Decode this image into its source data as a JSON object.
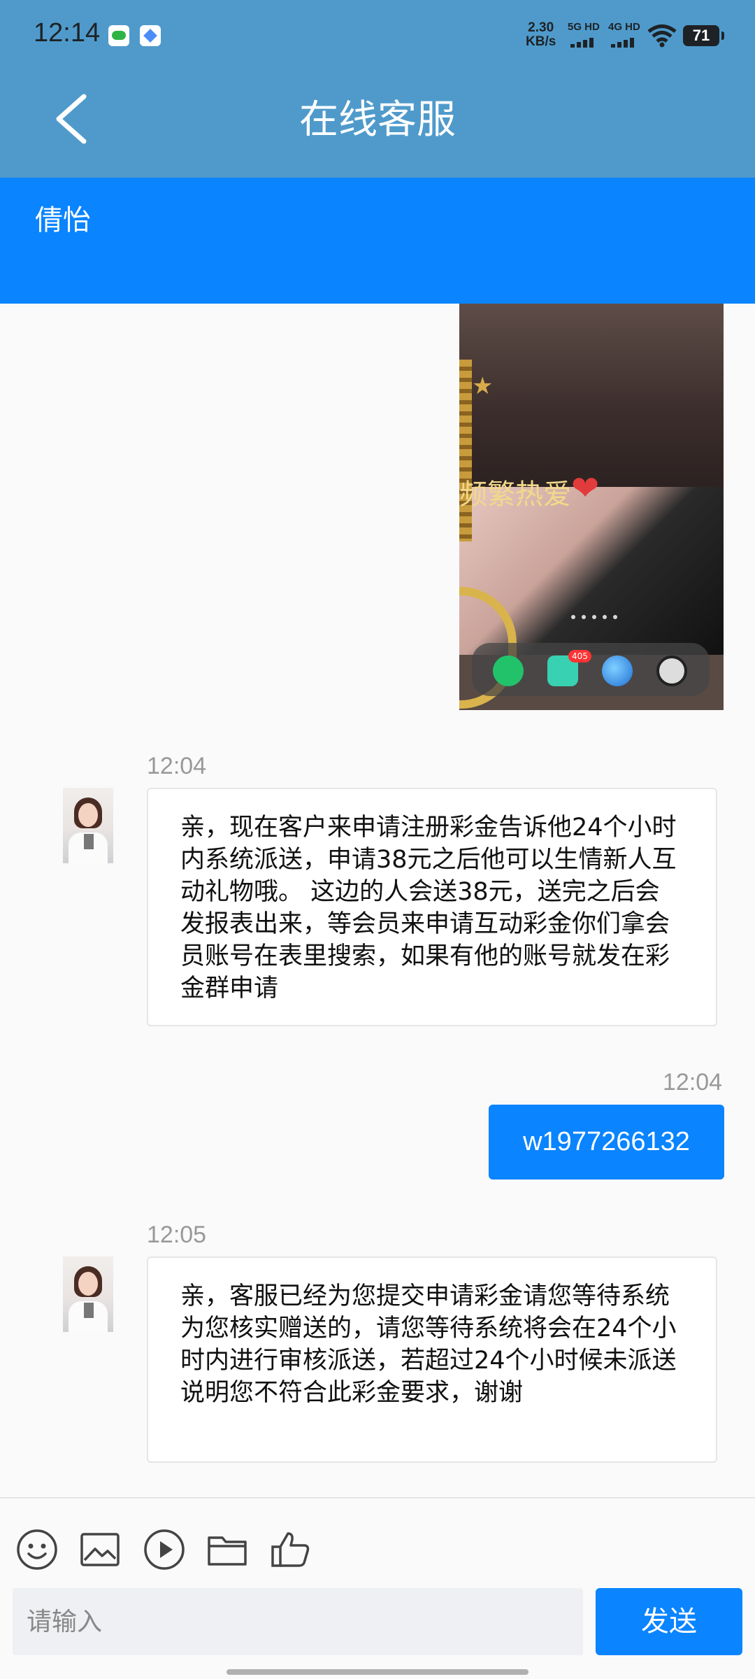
{
  "status_bar": {
    "time": "12:14",
    "net_speed_value": "2.30",
    "net_speed_unit": "KB/s",
    "sim1": "5G HD",
    "sim2": "4G HD",
    "battery": "71"
  },
  "header": {
    "title": "在线客服",
    "agent_name": "倩怡"
  },
  "image_message": {
    "overlay_text": "频繁热爱",
    "badge_count": "405"
  },
  "messages": [
    {
      "from": "agent",
      "time": "12:04",
      "text": "亲，现在客户来申请注册彩金告诉他24个小时内系统派送，申请38元之后他可以生情新人互动礼物哦。 这边的人会送38元，送完之后会发报表出来，等会员来申请互动彩金你们拿会员账号在表里搜索，如果有他的账号就发在彩金群申请"
    },
    {
      "from": "user",
      "time": "12:04",
      "text": "w1977266132"
    },
    {
      "from": "agent",
      "time": "12:05",
      "text": "亲，客服已经为您提交申请彩金请您等待系统为您核实赠送的，请您等待系统将会在24个小时内进行审核派送，若超过24个小时候未派送说明您不符合此彩金要求，谢谢"
    }
  ],
  "composer": {
    "placeholder": "请输入",
    "send_label": "发送",
    "tools": [
      "emoji-icon",
      "image-icon",
      "video-icon",
      "folder-icon",
      "thumbs-up-icon"
    ]
  },
  "colors": {
    "appbar": "#4f9acb",
    "agent_bar": "#0a84ff",
    "accent": "#0a84ff"
  }
}
